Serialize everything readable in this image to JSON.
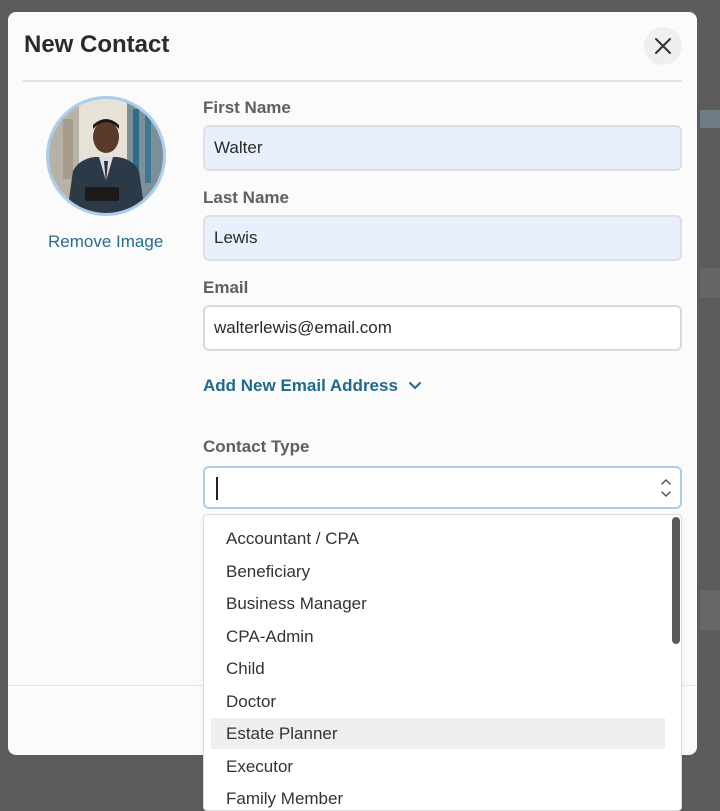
{
  "modal": {
    "title": "New Contact",
    "close_icon": "close-icon",
    "remove_image_label": "Remove Image"
  },
  "form": {
    "first_name": {
      "label": "First Name",
      "value": "Walter"
    },
    "last_name": {
      "label": "Last Name",
      "value": "Lewis"
    },
    "email": {
      "label": "Email",
      "value": "walterlewis@email.com"
    },
    "add_email_label": "Add New Email Address",
    "contact_type": {
      "label": "Contact Type",
      "value": "",
      "options": [
        "Accountant / CPA",
        "Beneficiary",
        "Business Manager",
        "CPA-Admin",
        "Child",
        "Doctor",
        "Estate Planner",
        "Executor",
        "Family Member"
      ],
      "highlighted_option": "Estate Planner"
    }
  },
  "colors": {
    "accent": "#1d6a8e",
    "link": "#266e8c",
    "autofill_bg": "#e8f0fe",
    "focus_border": "#a9cdea"
  }
}
